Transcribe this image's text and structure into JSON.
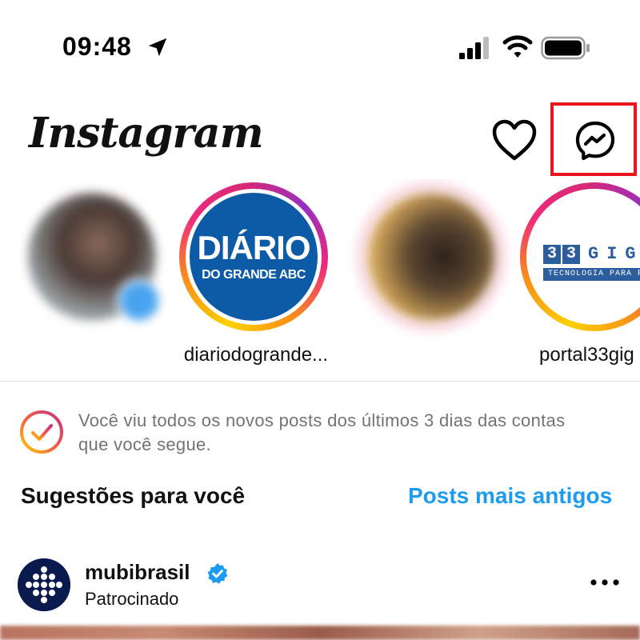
{
  "status_bar": {
    "time": "09:48",
    "location_icon": "location-arrow-icon",
    "signal_icon": "cellular-signal-icon",
    "wifi_icon": "wifi-icon",
    "battery_icon": "battery-icon"
  },
  "header": {
    "logo_text": "Instagram",
    "activity_icon": "heart-icon",
    "messenger_icon": "messenger-icon",
    "highlight_color": "#e8141e"
  },
  "stories": [
    {
      "username": "",
      "blurred": true
    },
    {
      "username": "diariodogrande...",
      "avatar_title": "DIÁRIO",
      "avatar_subtitle": "DO GRANDE ABC"
    },
    {
      "username": "",
      "blurred": true
    },
    {
      "username": "portal33gig",
      "avatar_title": "33GIG",
      "avatar_subtitle": "TECNOLOGIA PARA PESS"
    }
  ],
  "caught_up": {
    "icon": "checkmark-circle-icon",
    "message": "Você viu todos os novos posts dos últimos 3 dias das contas que você segue."
  },
  "suggestions": {
    "title": "Sugestões para você",
    "older_posts_link": "Posts mais antigos",
    "link_color": "#1d9bf0"
  },
  "post": {
    "username": "mubibrasil",
    "verified_icon": "verified-badge-icon",
    "subtitle": "Patrocinado",
    "more_icon": "more-horizontal-icon"
  }
}
